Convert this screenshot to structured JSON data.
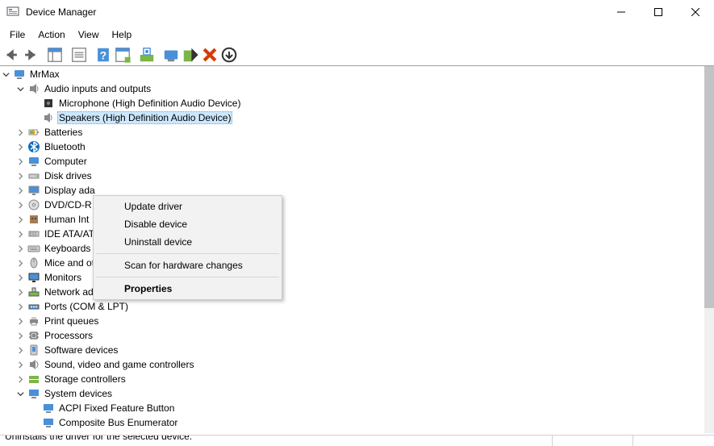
{
  "window": {
    "title": "Device Manager"
  },
  "menu": {
    "items": [
      "File",
      "Action",
      "View",
      "Help"
    ]
  },
  "tree": {
    "root": "MrMax",
    "categories": [
      {
        "label": "Audio inputs and outputs",
        "expanded": true,
        "icon": "audio",
        "children": [
          {
            "label": "Microphone (High Definition Audio Device)",
            "icon": "mic"
          },
          {
            "label": "Speakers (High Definition Audio Device)",
            "icon": "speaker",
            "selected": true
          }
        ]
      },
      {
        "label": "Batteries",
        "icon": "battery"
      },
      {
        "label": "Bluetooth",
        "icon": "bluetooth"
      },
      {
        "label": "Computer",
        "icon": "computer",
        "truncated": true
      },
      {
        "label": "Disk drives",
        "icon": "disk"
      },
      {
        "label": "Display ada",
        "icon": "display",
        "truncated": true
      },
      {
        "label": "DVD/CD-R",
        "icon": "dvd",
        "truncated": true
      },
      {
        "label": "Human Int",
        "icon": "hid",
        "truncated": true
      },
      {
        "label": "IDE ATA/ATAPI controllers",
        "icon": "ide"
      },
      {
        "label": "Keyboards",
        "icon": "keyboard"
      },
      {
        "label": "Mice and other pointing devices",
        "icon": "mouse"
      },
      {
        "label": "Monitors",
        "icon": "monitor"
      },
      {
        "label": "Network adapters",
        "icon": "network"
      },
      {
        "label": "Ports (COM & LPT)",
        "icon": "port"
      },
      {
        "label": "Print queues",
        "icon": "printer"
      },
      {
        "label": "Processors",
        "icon": "cpu"
      },
      {
        "label": "Software devices",
        "icon": "software"
      },
      {
        "label": "Sound, video and game controllers",
        "icon": "sound"
      },
      {
        "label": "Storage controllers",
        "icon": "storage"
      },
      {
        "label": "System devices",
        "expanded": true,
        "icon": "system",
        "children": [
          {
            "label": "ACPI Fixed Feature Button",
            "icon": "sysdev"
          },
          {
            "label": "Composite Bus Enumerator",
            "icon": "sysdev"
          }
        ]
      }
    ]
  },
  "contextMenu": {
    "items": [
      {
        "label": "Update driver"
      },
      {
        "label": "Disable device"
      },
      {
        "label": "Uninstall device"
      },
      {
        "separator": true
      },
      {
        "label": "Scan for hardware changes"
      },
      {
        "separator": true
      },
      {
        "label": "Properties",
        "bold": true
      }
    ]
  },
  "status": {
    "text": "Uninstalls the driver for the selected device."
  }
}
